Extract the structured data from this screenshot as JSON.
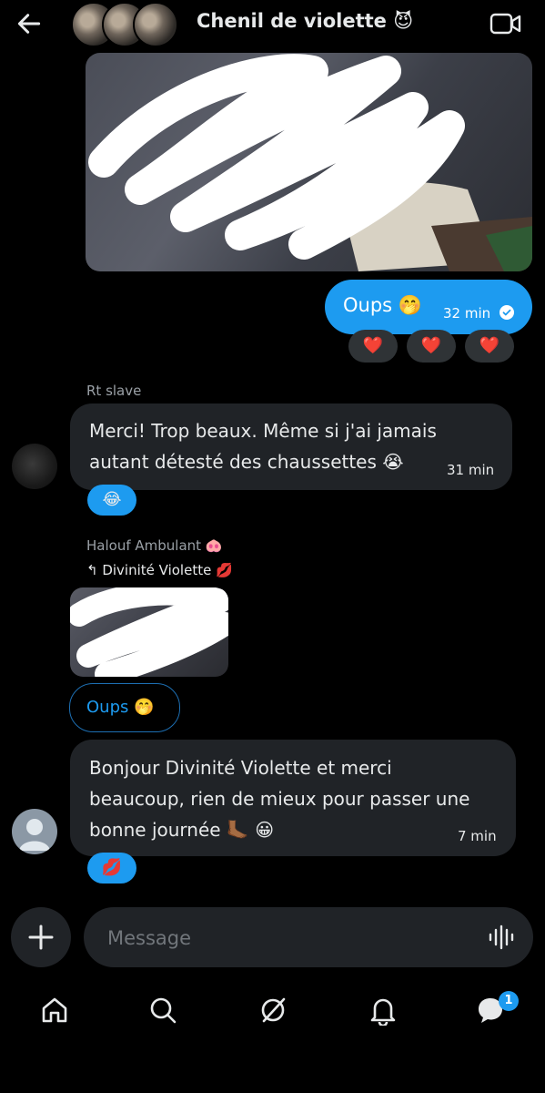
{
  "header": {
    "title": "Chenil de violette",
    "title_emoji": "😈"
  },
  "messages": {
    "outgoing": {
      "text": "Oups 🤭",
      "time": "32 min",
      "reactions": [
        "❤️",
        "❤️",
        "❤️"
      ]
    },
    "rt_slave": {
      "sender": "Rt slave",
      "line1": "Merci! Trop beaux. Même si j'ai jamais",
      "line2": "autant détesté des chaussettes 😭",
      "time": "31 min",
      "reaction": "😂"
    },
    "halouf": {
      "sender": "Halouf Ambulant 🐽",
      "reply_to": "↰ Divinité Violette 💋",
      "quote": "Oups 🤭"
    },
    "last": {
      "line1": "Bonjour Divinité Violette et merci",
      "line2": "beaucoup, rien de mieux pour passer une",
      "line3": "bonne journée 🦶🏾 😀",
      "time": "7 min",
      "reaction": "💋"
    }
  },
  "composer": {
    "placeholder": "Message"
  },
  "nav": {
    "badge_count": "1"
  },
  "colors": {
    "accent": "#1d9bf0",
    "bubble_in": "#202327",
    "background": "#000000"
  }
}
